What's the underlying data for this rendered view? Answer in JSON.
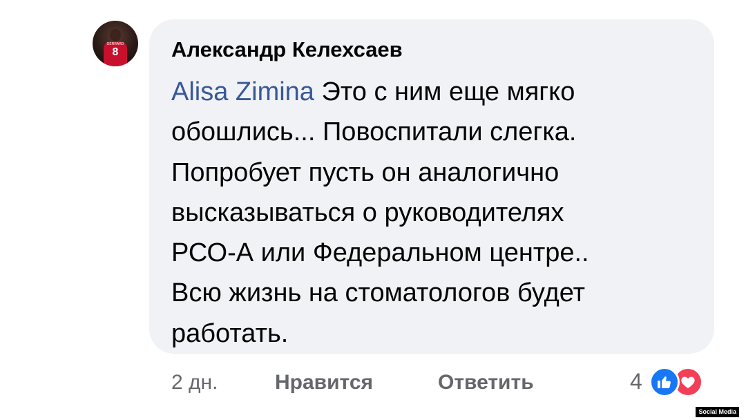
{
  "comment": {
    "author": "Александр Келехсаев",
    "mention": "Alisa Zimina",
    "text_lines": [
      " Это с ним еще мягко",
      "обошлись... Повоспитали слегка.",
      "Попробует пусть он аналогично",
      "высказываться о руководителях",
      "РСО-А или Федеральном центре..",
      "Всю жизнь на стоматологов будет",
      "работать."
    ],
    "avatar": {
      "jersey_number": "8",
      "jersey_name": "GERRARD"
    }
  },
  "actions": {
    "time": "2 дн.",
    "like_label": "Нравится",
    "reply_label": "Ответить"
  },
  "reactions": {
    "count": "4",
    "types": [
      "like-icon",
      "love-icon"
    ],
    "colors": {
      "like": "#1877f2",
      "love": "#f33e58"
    }
  },
  "watermark": "Social Media",
  "colors": {
    "bubble": "#f0f2f5",
    "mention": "#385898",
    "meta": "#65676b"
  }
}
